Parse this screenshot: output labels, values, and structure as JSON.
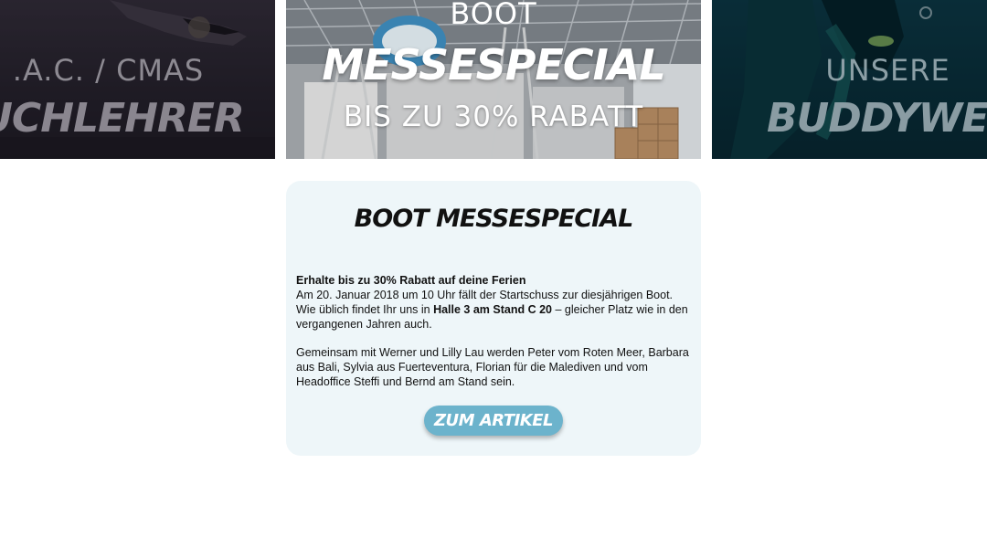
{
  "slides": {
    "left": {
      "kicker": ".A.C. / CMAS",
      "script": "UCHLEHRER"
    },
    "center": {
      "kicker": "BOOT",
      "script": "MESSESPECIAL",
      "subline": "BIS ZU 30% RABATT"
    },
    "right": {
      "kicker": "UNSERE",
      "script": "BUDDYWEEK"
    }
  },
  "card": {
    "title": "BOOT MESSESPECIAL",
    "lead": "Erhalte bis zu 30% Rabatt auf deine Ferien",
    "p1_line1": "Am 20. Januar 2018 um 10 Uhr fällt der Startschuss zur diesjährigen Boot.",
    "p1_part1": "Wie üblich findet Ihr uns in ",
    "p1_bold": "Halle 3 am Stand C 20",
    "p1_part2": " – gleicher Platz wie in den vergangenen Jahren auch.",
    "p2": "Gemeinsam mit Werner und Lilly Lau werden Peter vom Roten Meer, Barbara aus Bali, Sylvia aus Fuerteventura, Florian für die Malediven und vom Headoffice Steffi und Bernd am Stand sein.",
    "cta": "ZUM ARTIKEL"
  },
  "colors": {
    "card_bg": "#eef6f9",
    "cta_bg": "#6cb3cc"
  }
}
